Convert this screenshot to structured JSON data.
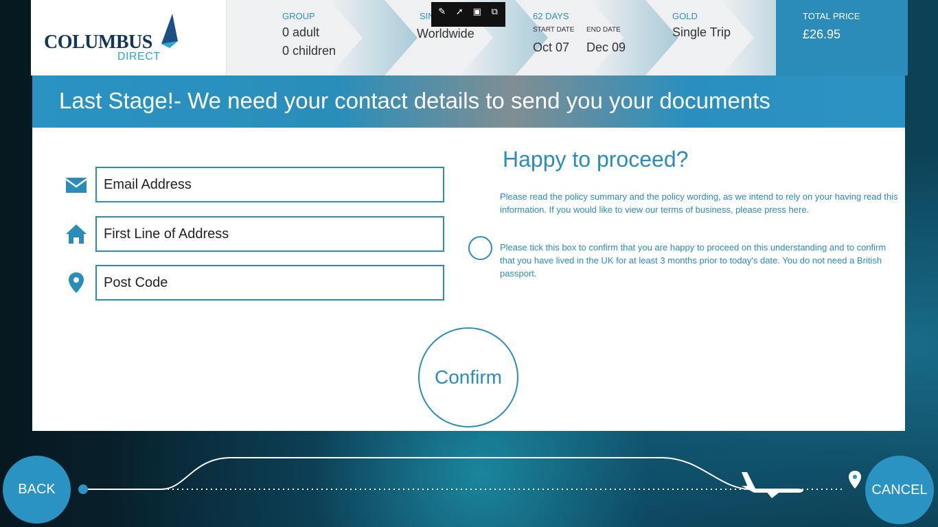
{
  "logo": {
    "main": "COLUMBUS",
    "sub": "DIRECT"
  },
  "steps": {
    "group": {
      "label": "GROUP",
      "adults": "0 adult",
      "children": "0 children"
    },
    "destination": {
      "label": "SIN",
      "value": "Worldwide"
    },
    "dates": {
      "label": "62 DAYS",
      "start_label": "START DATE",
      "start": "Oct 07",
      "end_label": "END DATE",
      "end": "Dec 09"
    },
    "cover": {
      "label": "GOLD",
      "value": "Single Trip"
    },
    "total": {
      "label": "TOTAL PRICE",
      "value": "£26.95"
    }
  },
  "banner": {
    "title": "Last Stage!- We need your contact details to send you your documents"
  },
  "form": {
    "email_placeholder": "Email Address",
    "address_placeholder": "First Line of Address",
    "postcode_placeholder": "Post Code"
  },
  "proceed": {
    "heading": "Happy to proceed?",
    "policy_text": "Please read the policy summary and the policy wording, as we intend to rely on your having read this information. If you would like to view our terms of business, please press here.",
    "confirm_text": "Please tick this box to confirm that you are happy to proceed on this understanding and to confirm that you have lived in the UK for at least 3 months prior to today's date. You do not need a British passport."
  },
  "confirm_button": "Confirm",
  "footer": {
    "back": "BACK",
    "cancel": "CANCEL"
  },
  "colors": {
    "accent": "#2b8cba",
    "brand_navy": "#14365a"
  }
}
